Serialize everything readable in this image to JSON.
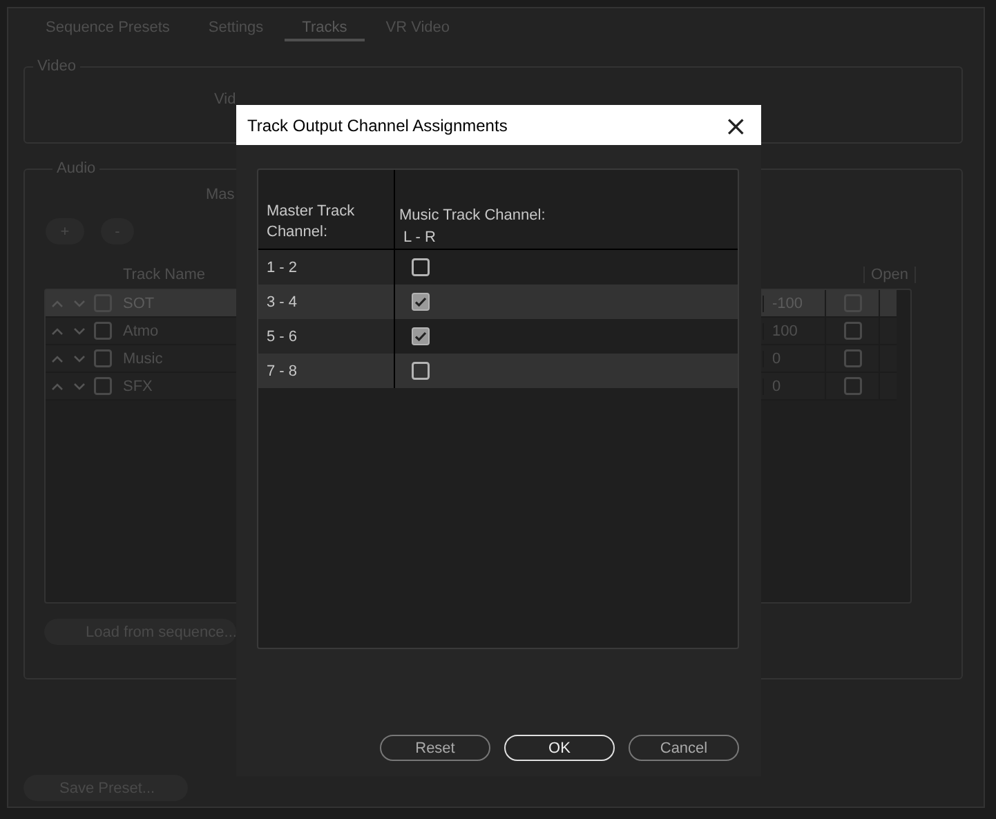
{
  "tabs": [
    {
      "label": "Sequence Presets",
      "selected": false
    },
    {
      "label": "Settings",
      "selected": false
    },
    {
      "label": "Tracks",
      "selected": true
    },
    {
      "label": "VR Video",
      "selected": false
    }
  ],
  "video_group": {
    "title": "Video",
    "label": "Vid"
  },
  "audio_group": {
    "title": "Audio",
    "label": "Mas",
    "add_button": "+",
    "remove_button": "-",
    "track_table": {
      "columns": [
        "Track Name",
        "Open"
      ],
      "rows": [
        {
          "enabled": false,
          "name": "SOT",
          "value": "-100",
          "open": false,
          "selected": true
        },
        {
          "enabled": false,
          "name": "Atmo",
          "value": "100",
          "open": false,
          "selected": false
        },
        {
          "enabled": false,
          "name": "Music",
          "value": "0",
          "open": false,
          "selected": false
        },
        {
          "enabled": false,
          "name": "SFX",
          "value": "0",
          "open": false,
          "selected": false
        }
      ]
    },
    "load_button": "Load from sequence..."
  },
  "save_preset_button": "Save Preset...",
  "dialog": {
    "title": "Track Output Channel Assignments",
    "close": "×",
    "row_header": "Master Track Channel:",
    "column_header": "Music Track Channel:",
    "column_subheader": "L - R",
    "rows": [
      {
        "channel": "1 - 2",
        "checked": false
      },
      {
        "channel": "3 - 4",
        "checked": true
      },
      {
        "channel": "5 - 6",
        "checked": true
      },
      {
        "channel": "7 - 8",
        "checked": false
      }
    ],
    "buttons": [
      {
        "label": "Reset",
        "default": false
      },
      {
        "label": "OK",
        "default": true
      },
      {
        "label": "Cancel",
        "default": false
      }
    ]
  }
}
